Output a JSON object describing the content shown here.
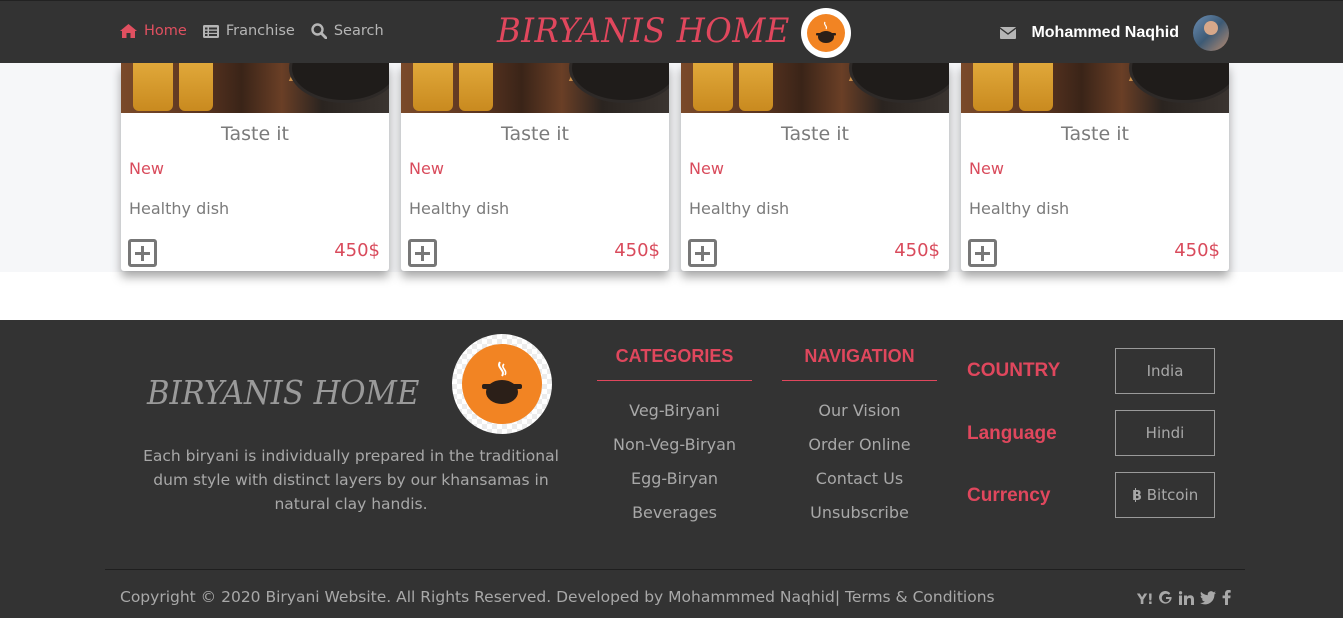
{
  "nav": {
    "home": "Home",
    "franchise": "Franchise",
    "search": "Search",
    "brand": "BIRYANIS HOME",
    "username": "Mohammed Naqhid"
  },
  "cards": [
    {
      "title": "Taste it",
      "badge": "New",
      "desc": "Healthy dish",
      "price": "450$"
    },
    {
      "title": "Taste it",
      "badge": "New",
      "desc": "Healthy dish",
      "price": "450$"
    },
    {
      "title": "Taste it",
      "badge": "New",
      "desc": "Healthy dish",
      "price": "450$"
    },
    {
      "title": "Taste it",
      "badge": "New",
      "desc": "Healthy dish",
      "price": "450$"
    }
  ],
  "footer": {
    "brand": "BIRYANIS HOME",
    "description": "Each biryani is individually prepared in the traditional dum style with distinct layers by our khansamas in natural clay handis.",
    "categories": {
      "title": "CATEGORIES",
      "items": [
        "Veg-Biryani",
        "Non-Veg-Biryan",
        "Egg-Biryan",
        "Beverages"
      ]
    },
    "navigation": {
      "title": "NAVIGATION",
      "items": [
        "Our Vision",
        "Order Online",
        "Contact Us",
        "Unsubscribe"
      ]
    },
    "country": {
      "label": "COUNTRY",
      "value": "India"
    },
    "language": {
      "label": "Language",
      "value": "Hindi"
    },
    "currency": {
      "label": "Currency",
      "value": "Bitcoin"
    },
    "copyright": "Copyright © 2020 Biryani Website. All Rights Reserved. Developed by Mohammmed Naqhid| Terms & Conditions"
  },
  "colors": {
    "accent": "#e0475d",
    "navbar": "#333333",
    "footer": "#333333",
    "logo_orange": "#f28423"
  },
  "icons": {
    "nav": [
      "home-icon",
      "list-icon",
      "search-icon",
      "envelope-icon"
    ],
    "social": [
      "yelp-icon",
      "google-icon",
      "linkedin-icon",
      "twitter-icon",
      "facebook-icon"
    ]
  }
}
